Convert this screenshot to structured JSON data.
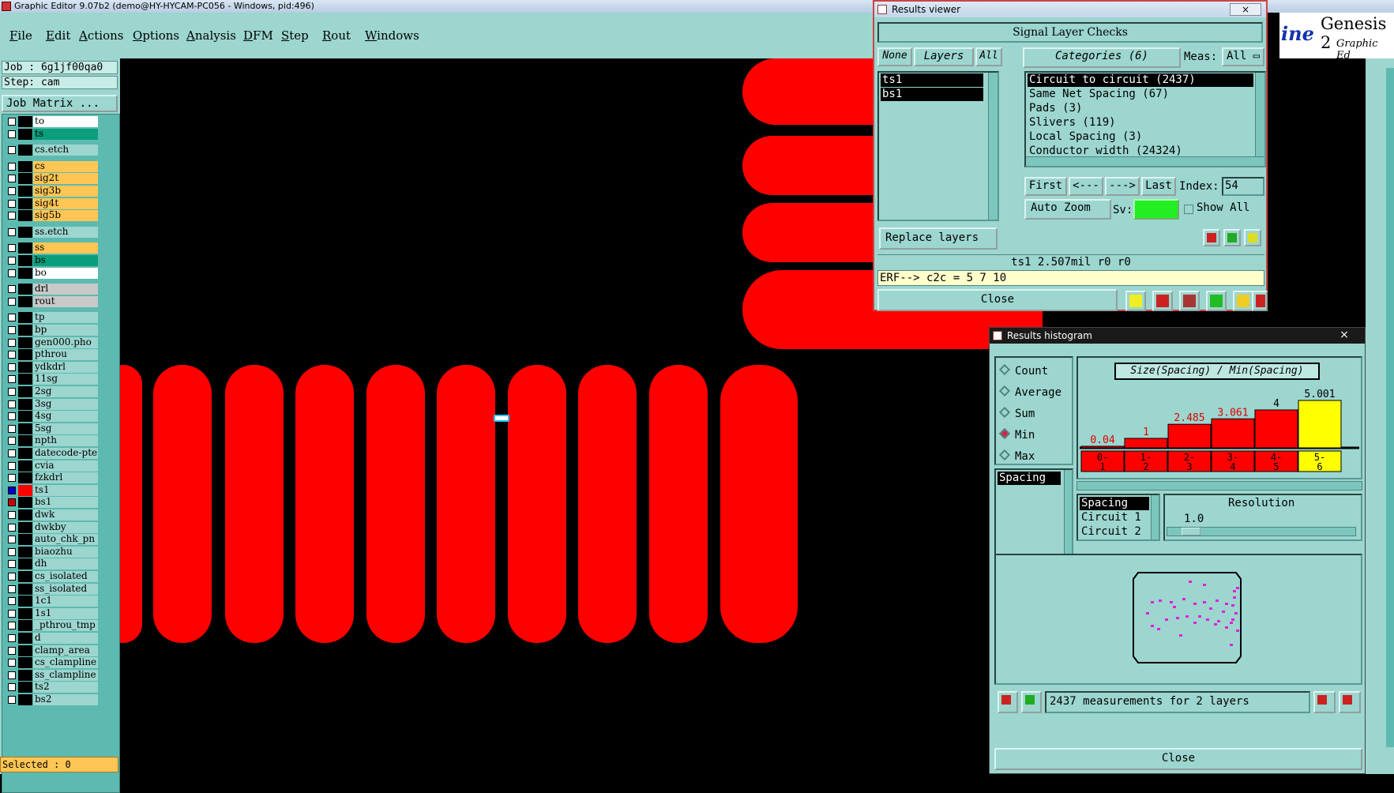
{
  "app": {
    "title": "Graphic Editor 9.07b2 (demo@HY-HYCAM-PC056 - Windows, pid:496)",
    "logo_text": "Genesis 2",
    "logo_sub": "Graphic Ed",
    "logo_partial": "ine"
  },
  "menu": [
    "File",
    "Edit",
    "Actions",
    "Options",
    "Analysis",
    "DFM",
    "Step",
    "Rout",
    "Windows"
  ],
  "left": {
    "job": "Job : 6g1jf00qa0",
    "step": "Step: cam",
    "job_matrix": "Job Matrix ...",
    "selected": "Selected : 0",
    "layers": [
      {
        "name": "to",
        "color": "#ffffff",
        "state": "off"
      },
      {
        "name": "ts",
        "color": "#0a9e7c",
        "state": "off"
      },
      {
        "name": "cs.etch",
        "color": "#9cd6cf",
        "state": "off"
      },
      {
        "name": "cs",
        "color": "#ffc655",
        "state": "off"
      },
      {
        "name": "sig2t",
        "color": "#ffc655",
        "state": "off"
      },
      {
        "name": "sig3b",
        "color": "#ffc655",
        "state": "off"
      },
      {
        "name": "sig4t",
        "color": "#ffc655",
        "state": "off"
      },
      {
        "name": "sig5b",
        "color": "#ffc655",
        "state": "off"
      },
      {
        "name": "ss.etch",
        "color": "#9cd6cf",
        "state": "off"
      },
      {
        "name": "ss",
        "color": "#ffc655",
        "state": "off"
      },
      {
        "name": "bs",
        "color": "#0a9e7c",
        "state": "off"
      },
      {
        "name": "bo",
        "color": "#ffffff",
        "state": "off"
      },
      {
        "name": "drl",
        "color": "#c9c9c9",
        "state": "off"
      },
      {
        "name": "rout",
        "color": "#c9c9c9",
        "state": "off"
      },
      {
        "name": "tp",
        "color": "#9cd6cf",
        "state": "off"
      },
      {
        "name": "bp",
        "color": "#9cd6cf",
        "state": "off"
      },
      {
        "name": "gen000.pho",
        "color": "#9cd6cf",
        "state": "off"
      },
      {
        "name": "pthrou",
        "color": "#9cd6cf",
        "state": "off"
      },
      {
        "name": "ydkdrl",
        "color": "#9cd6cf",
        "state": "off"
      },
      {
        "name": "11sg",
        "color": "#9cd6cf",
        "state": "off"
      },
      {
        "name": "2sg",
        "color": "#9cd6cf",
        "state": "off"
      },
      {
        "name": "3sg",
        "color": "#9cd6cf",
        "state": "off"
      },
      {
        "name": "4sg",
        "color": "#9cd6cf",
        "state": "off"
      },
      {
        "name": "5sg",
        "color": "#9cd6cf",
        "state": "off"
      },
      {
        "name": "npth",
        "color": "#9cd6cf",
        "state": "off"
      },
      {
        "name": "datecode-pte",
        "color": "#9cd6cf",
        "state": "off"
      },
      {
        "name": "cvia",
        "color": "#9cd6cf",
        "state": "off"
      },
      {
        "name": "fzkdrl",
        "color": "#9cd6cf",
        "state": "off"
      },
      {
        "name": "ts1",
        "color": "#9cd6cf",
        "state": "work"
      },
      {
        "name": "bs1",
        "color": "#9cd6cf",
        "state": "on"
      },
      {
        "name": "dwk",
        "color": "#9cd6cf",
        "state": "off"
      },
      {
        "name": "dwkby",
        "color": "#9cd6cf",
        "state": "off"
      },
      {
        "name": "auto_chk_pn",
        "color": "#9cd6cf",
        "state": "off"
      },
      {
        "name": "biaozhu",
        "color": "#9cd6cf",
        "state": "off"
      },
      {
        "name": "dh",
        "color": "#9cd6cf",
        "state": "off"
      },
      {
        "name": "cs_isolated",
        "color": "#9cd6cf",
        "state": "off"
      },
      {
        "name": "ss_isolated",
        "color": "#9cd6cf",
        "state": "off"
      },
      {
        "name": "1c1",
        "color": "#9cd6cf",
        "state": "off"
      },
      {
        "name": "1s1",
        "color": "#9cd6cf",
        "state": "off"
      },
      {
        "name": "_pthrou_tmp",
        "color": "#9cd6cf",
        "state": "off"
      },
      {
        "name": "d",
        "color": "#9cd6cf",
        "state": "off"
      },
      {
        "name": "clamp_area",
        "color": "#9cd6cf",
        "state": "off"
      },
      {
        "name": "cs_clampline",
        "color": "#9cd6cf",
        "state": "off"
      },
      {
        "name": "ss_clampline",
        "color": "#9cd6cf",
        "state": "off"
      },
      {
        "name": "ts2",
        "color": "#9cd6cf",
        "state": "off"
      },
      {
        "name": "bs2",
        "color": "#9cd6cf",
        "state": "off"
      }
    ]
  },
  "results_viewer": {
    "title": "Results viewer",
    "close_x": "×",
    "header": "Signal Layer Checks",
    "none_btn": "None",
    "layers_btn": "Layers",
    "all_btn": "All",
    "categories_label": "Categories (6)",
    "meas_label": "Meas:",
    "meas_value": "All",
    "layer_items": [
      "ts1",
      "bs1"
    ],
    "categories": [
      "Circuit to circuit (2437)",
      "Same Net Spacing (67)",
      "Pads (3)",
      "Slivers (119)",
      "Local Spacing (3)",
      "Conductor width (24324)"
    ],
    "first": "First",
    "prev": "<---",
    "next": "--->",
    "last": "Last",
    "index_label": "Index:",
    "index_value": "54",
    "auto_zoom": "Auto Zoom",
    "sv_label": "Sv:",
    "show_all": "Show All",
    "replace_layers": "Replace layers",
    "status": "ts1 2.507mil  r0  r0",
    "erf": "ERF--> c2c = 5 7 10",
    "close": "Close",
    "icons": {
      "del": "DEL",
      "ref": "REF",
      "undo": "UNDO"
    }
  },
  "histogram": {
    "title": "Results histogram",
    "close_x": "×",
    "modes": [
      {
        "label": "Count",
        "selected": false
      },
      {
        "label": "Average",
        "selected": false
      },
      {
        "label": "Sum",
        "selected": false
      },
      {
        "label": "Min",
        "selected": true
      },
      {
        "label": "Max",
        "selected": false
      }
    ],
    "measure_list": [
      "Spacing"
    ],
    "chart_title": "Size(Spacing) / Min(Spacing)",
    "resolution_label": "Resolution",
    "resolution_value": "1.0",
    "attrs": [
      "Spacing",
      "Circuit 1",
      "Circuit 2"
    ],
    "footer": "2437 measurements for 2 layers",
    "close": "Close",
    "icons": {
      "del": "DEL",
      "ref": "REF"
    }
  },
  "chart_data": {
    "type": "bar",
    "title": "Size(Spacing) / Min(Spacing)",
    "categories": [
      "0-1",
      "1-2",
      "2-3",
      "3-4",
      "4-5",
      "5-6"
    ],
    "values": [
      0.04,
      1,
      2.485,
      3.061,
      4,
      5.001
    ],
    "value_labels": [
      "0.04",
      "1",
      "2.485",
      "3.061",
      "4",
      "5.001"
    ],
    "ylim": [
      0,
      5.5
    ],
    "highlight_index": 5,
    "colors": {
      "bar": "#ff0000",
      "highlight": "#ffff00",
      "label": "#e00000"
    }
  },
  "colors": {
    "teal": "#9cd6cf",
    "pad_red": "#ff0000",
    "sv_green": "#22ee22"
  }
}
